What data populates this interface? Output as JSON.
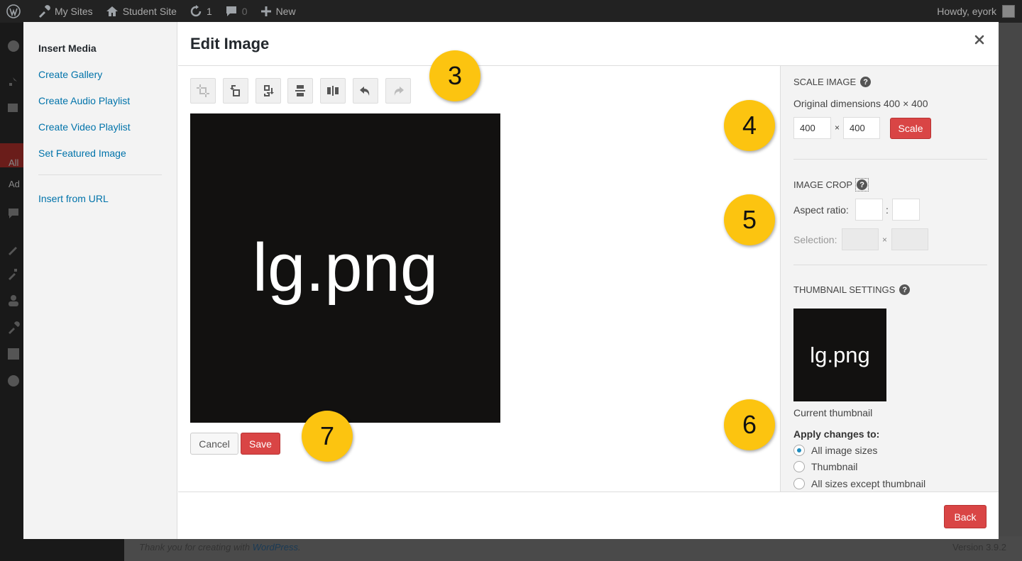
{
  "admin_bar": {
    "my_sites": "My Sites",
    "site_name": "Student Site",
    "updates_count": "1",
    "comments_count": "0",
    "new_label": "New",
    "greeting": "Howdy, eyork"
  },
  "admin_menu": {
    "partial_all": "All",
    "partial_add": "Ad"
  },
  "footer": {
    "thanks_prefix": "Thank you for creating with ",
    "thanks_link": "WordPress",
    "thanks_suffix": ".",
    "version": "Version 3.9.2"
  },
  "media_menu": {
    "title": "Insert Media",
    "items": [
      "Create Gallery",
      "Create Audio Playlist",
      "Create Video Playlist",
      "Set Featured Image"
    ],
    "insert_from_url": "Insert from URL"
  },
  "frame": {
    "title": "Edit Image"
  },
  "editor": {
    "image_text": "lg.png",
    "cancel_label": "Cancel",
    "save_label": "Save"
  },
  "sidebar": {
    "scale_image": {
      "heading": "SCALE IMAGE",
      "original_dimensions": "Original dimensions 400 × 400",
      "width": "400",
      "height": "400",
      "times": "×",
      "scale_label": "Scale"
    },
    "image_crop": {
      "heading": "IMAGE CROP",
      "aspect_ratio_label": "Aspect ratio:",
      "colon": ":",
      "selection_label": "Selection:",
      "times": "×"
    },
    "thumbnail_settings": {
      "heading": "THUMBNAIL SETTINGS",
      "thumb_text": "lg.png",
      "current_thumbnail": "Current thumbnail",
      "apply_changes_to": "Apply changes to:",
      "options": [
        "All image sizes",
        "Thumbnail",
        "All sizes except thumbnail"
      ],
      "selected": "All image sizes"
    }
  },
  "toolbar": {
    "back_label": "Back"
  },
  "callouts": [
    "3",
    "4",
    "5",
    "6",
    "7"
  ],
  "colors": {
    "primary_button": "#d94545",
    "callout": "#fcc410",
    "link": "#0073aa",
    "admin_bar": "#222222"
  },
  "icons": {
    "toolbar": [
      "crop-icon",
      "rotate-left-icon",
      "rotate-right-icon",
      "flip-vertical-icon",
      "flip-horizontal-icon",
      "undo-icon",
      "redo-icon"
    ]
  }
}
